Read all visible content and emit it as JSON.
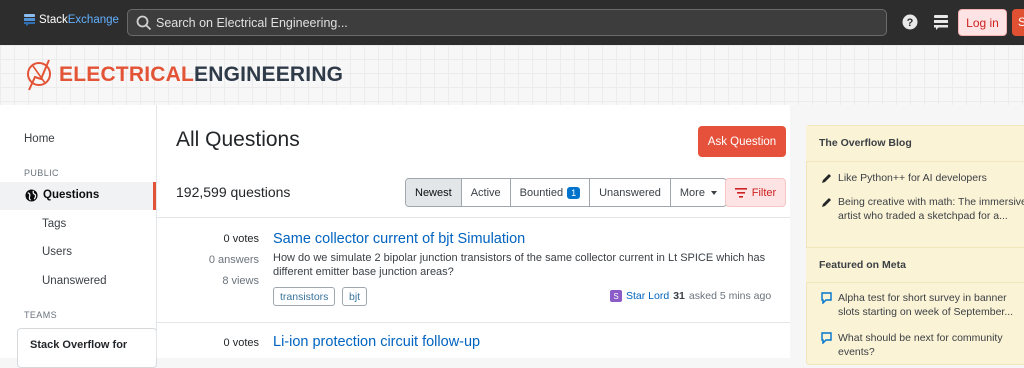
{
  "topbar": {
    "brand_stack": "Stack",
    "brand_exchange": "Exchange",
    "search_placeholder": "Search on Electrical Engineering...",
    "login_label": "Log in",
    "signup_label": "S"
  },
  "site": {
    "logo_part1": "ELECTRICAL",
    "logo_part2": "ENGINEERING"
  },
  "leftnav": {
    "home": "Home",
    "public_heading": "PUBLIC",
    "questions": "Questions",
    "tags": "Tags",
    "users": "Users",
    "unanswered": "Unanswered",
    "teams_heading": "TEAMS",
    "teams_box": "Stack Overflow for"
  },
  "main": {
    "title": "All Questions",
    "ask_button": "Ask Question",
    "question_count": "192,599 questions",
    "filters": [
      "Newest",
      "Active",
      "Bountied",
      "Unanswered",
      "More"
    ],
    "bountied_count": "1",
    "filter_button": "Filter"
  },
  "questions": [
    {
      "votes": "0 votes",
      "answers": "0 answers",
      "views": "8 views",
      "title": "Same collector current of bjt Simulation",
      "excerpt": "How do we simulate 2 bipolar junction transistors of the same collector current in Lt SPICE which has different emitter base junction areas?",
      "tags": [
        "transistors",
        "bjt"
      ],
      "user_initial": "S",
      "user_name": "Star Lord",
      "user_rep": "31",
      "asked": "asked 5 mins ago"
    },
    {
      "votes": "0 votes",
      "title": "Li-ion protection circuit follow-up"
    }
  ],
  "sidebar": {
    "blog_heading": "The Overflow Blog",
    "blog_items": [
      "Like Python++ for AI developers",
      "Being creative with math: The immersive artist who traded a sketchpad for a..."
    ],
    "meta_heading": "Featured on Meta",
    "meta_items": [
      "Alpha test for short survey in banner slots starting on week of September...",
      "What should be next for community events?"
    ]
  },
  "colors": {
    "accent": "#e35336",
    "link": "#0063bf",
    "topbar": "#2d2d2d"
  }
}
